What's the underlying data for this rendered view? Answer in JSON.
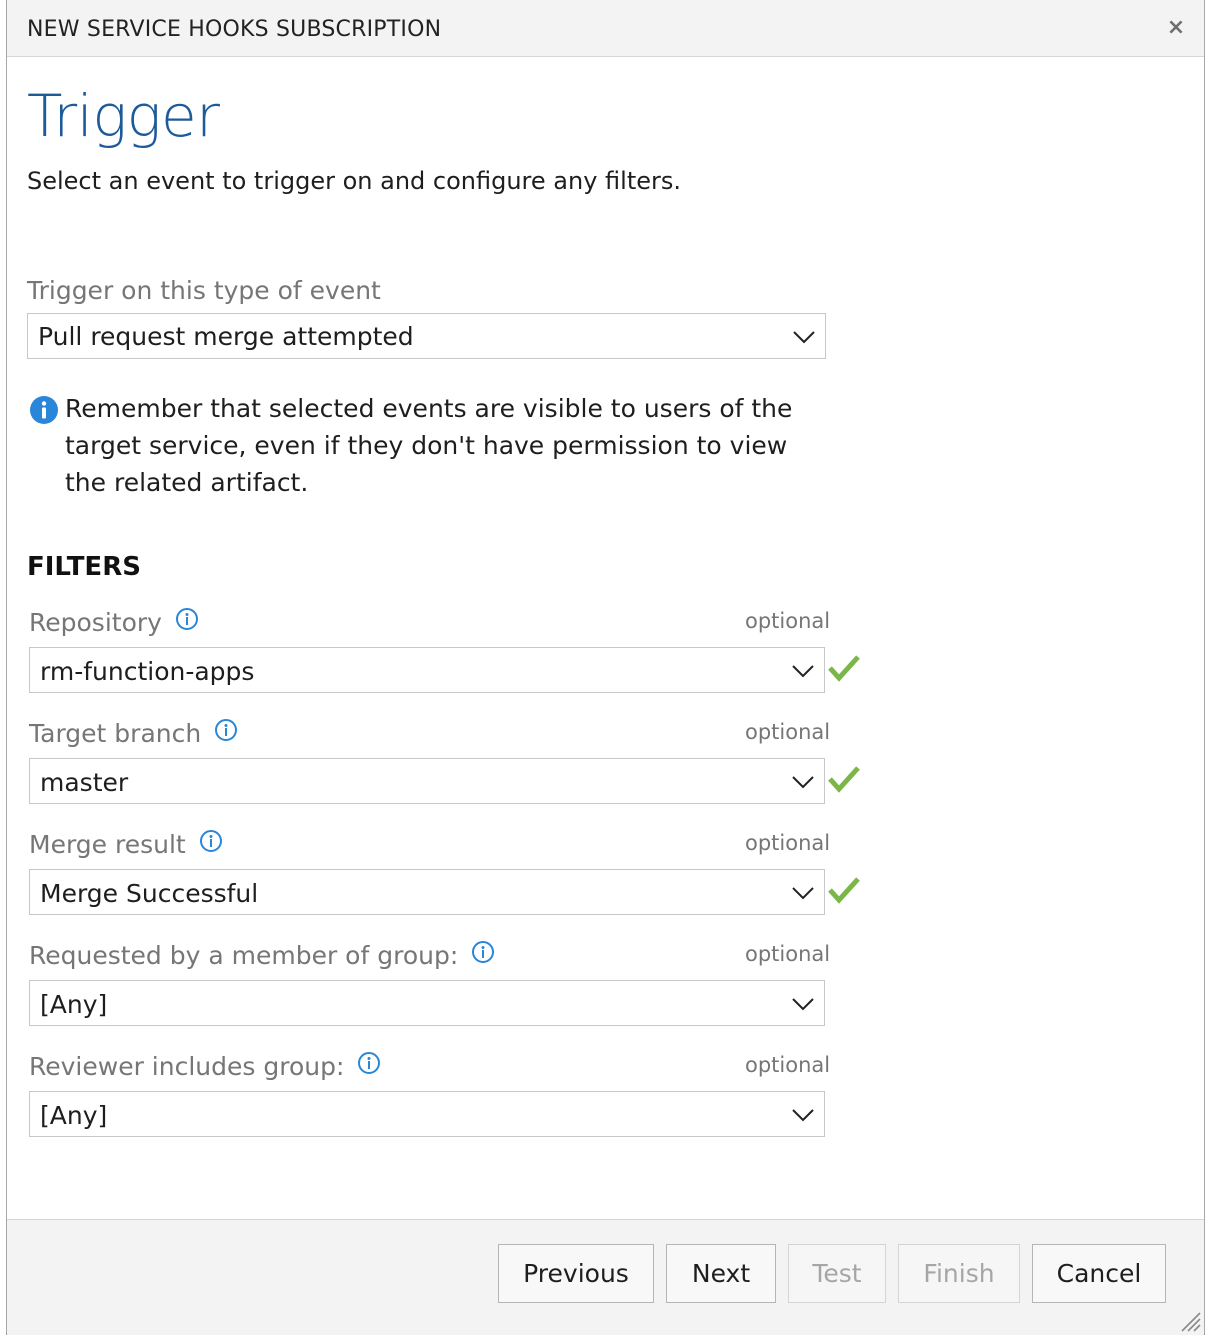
{
  "dialog": {
    "title": "NEW SERVICE HOOKS SUBSCRIPTION",
    "close_glyph": "×"
  },
  "page": {
    "heading": "Trigger",
    "subtitle": "Select an event to trigger on and configure any filters."
  },
  "event": {
    "label": "Trigger on this type of event",
    "selected": "Pull request merge attempted"
  },
  "notice": {
    "text": "Remember that selected events are visible to users of the target service, even if they don't have permission to view the related artifact."
  },
  "filters": {
    "heading": "FILTERS",
    "optional_text": "optional",
    "items": [
      {
        "label": "Repository",
        "value": "rm-function-apps",
        "valid": true
      },
      {
        "label": "Target branch",
        "value": "master",
        "valid": true
      },
      {
        "label": "Merge result",
        "value": "Merge Successful",
        "valid": true
      },
      {
        "label": "Requested by a member of group:",
        "value": "[Any]",
        "valid": false
      },
      {
        "label": "Reviewer includes group:",
        "value": "[Any]",
        "valid": false
      }
    ]
  },
  "footer": {
    "previous": "Previous",
    "next": "Next",
    "test": "Test",
    "finish": "Finish",
    "cancel": "Cancel"
  },
  "colors": {
    "heading": "#1d5a9a",
    "info_icon": "#2a86d8",
    "check": "#7ab648"
  },
  "icons": {
    "close": "close-icon",
    "dropdown": "chevron-down-icon",
    "info": "info-icon",
    "valid": "checkmark-icon",
    "resize": "resize-grip-icon"
  }
}
